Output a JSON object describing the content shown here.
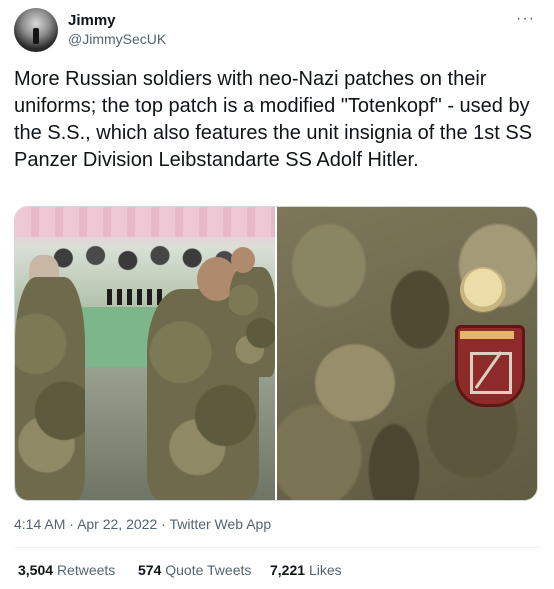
{
  "author": {
    "display_name": "Jimmy",
    "handle": "@JimmySecUK",
    "avatar_icon": "profile-photo"
  },
  "menu": {
    "more_icon": "ellipsis-icon",
    "more_label": "···"
  },
  "tweet": {
    "text": "More Russian soldiers with neo-Nazi patches on their uniforms; the top patch is a modified \"Totenkopf\" - used by the S.S., which also features the unit insignia of the 1st SS Panzer Division Leibstandarte SS Adolf Hitler."
  },
  "meta": {
    "time": "4:14 AM",
    "separator": "·",
    "date": "Apr 22, 2022",
    "source": "Twitter Web App"
  },
  "stats": {
    "retweets_count": "3,504",
    "retweets_label": "Retweets",
    "quotes_count": "574",
    "quotes_label": "Quote Tweets",
    "likes_count": "7,221",
    "likes_label": "Likes"
  },
  "colors": {
    "text": "#0f1419",
    "secondary": "#536471",
    "border": "#cfd9de"
  }
}
